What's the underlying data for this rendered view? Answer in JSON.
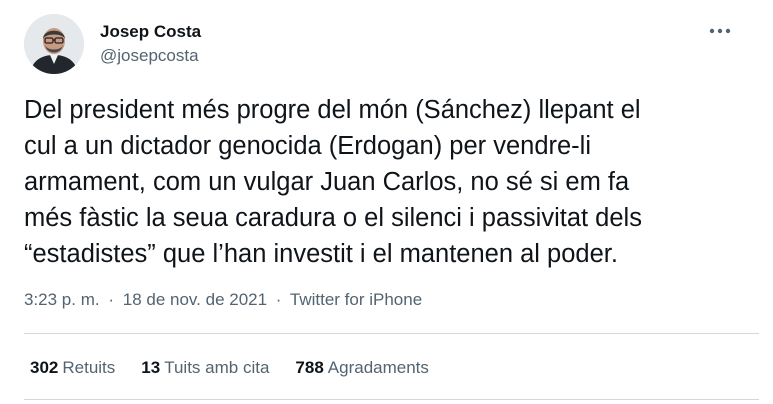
{
  "author": {
    "name": "Josep Costa",
    "handle": "@josepcosta"
  },
  "tweet": {
    "lines": [
      "Del president més progre del món (Sánchez) llepant el",
      "cul a un dictador genocida (Erdogan) per vendre-li",
      "armament, com un vulgar Juan Carlos, no sé si em fa",
      "més fàstic la seua caradura o el silenci i passivitat dels",
      "“estadistes” que l’han investit i el mantenen al poder."
    ]
  },
  "meta": {
    "time": "3:23 p. m.",
    "separator": "·",
    "date": "18 de nov. de 2021",
    "source": "Twitter for iPhone"
  },
  "stats": {
    "retweets_count": "302",
    "retweets_label": "Retuits",
    "quotes_count": "13",
    "quotes_label": "Tuits amb cita",
    "likes_count": "788",
    "likes_label": "Agradaments"
  },
  "icons": {
    "more": "more-horizontal-icon"
  },
  "colors": {
    "text": "#0f1419",
    "secondary": "#536471",
    "border": "#cfd9de"
  }
}
